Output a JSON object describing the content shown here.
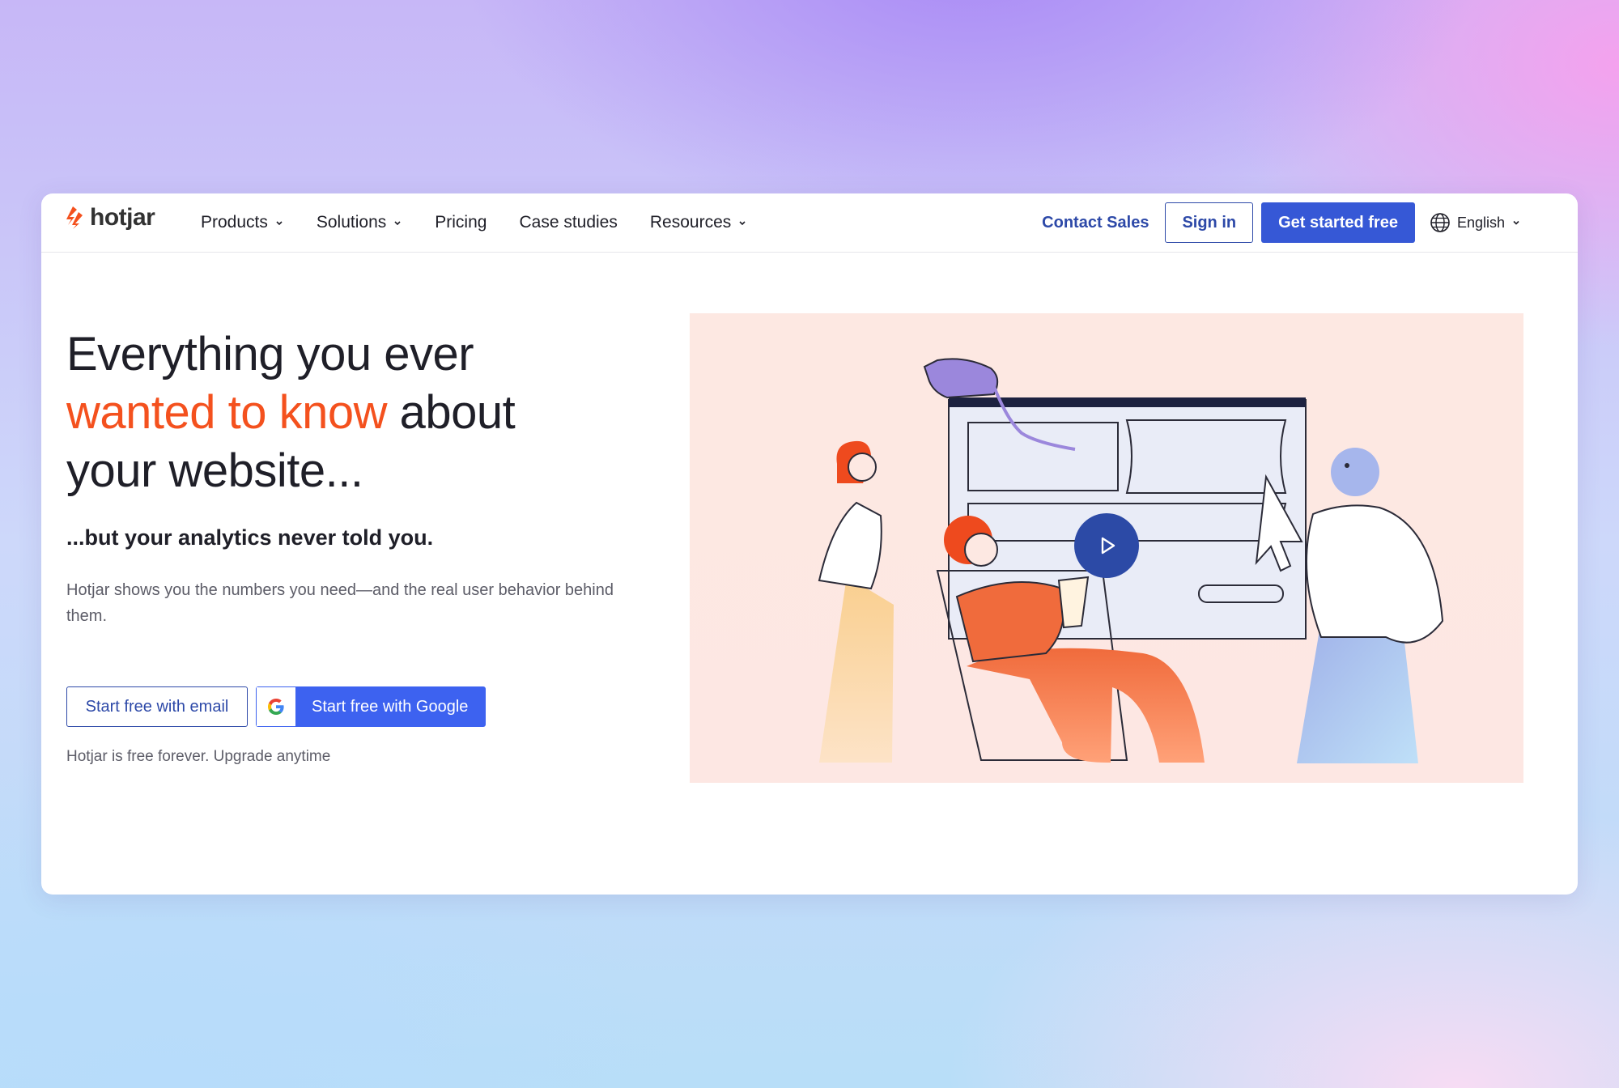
{
  "brand": {
    "name": "hotjar",
    "color": "#f4511e"
  },
  "nav": {
    "items": [
      {
        "label": "Products",
        "has_dropdown": true
      },
      {
        "label": "Solutions",
        "has_dropdown": true
      },
      {
        "label": "Pricing",
        "has_dropdown": false
      },
      {
        "label": "Case studies",
        "has_dropdown": false
      },
      {
        "label": "Resources",
        "has_dropdown": true
      }
    ],
    "contact_sales": "Contact Sales",
    "sign_in": "Sign in",
    "get_started": "Get started free",
    "language": "English"
  },
  "hero": {
    "headline_line1": "Everything you ever",
    "headline_accent": "wanted to know",
    "headline_after_accent": " about",
    "headline_line3": "your website...",
    "subheadline": "...but your analytics never told you.",
    "description": "Hotjar shows you the numbers you need—and the real user behavior behind them.",
    "cta_email": "Start free with email",
    "cta_google": "Start free with Google",
    "free_note": "Hotjar is free forever. Upgrade anytime"
  },
  "colors": {
    "primary_blue": "#3658d6",
    "link_blue": "#2d49a8",
    "accent_orange": "#f4511e",
    "hero_bg": "#fde8e2"
  }
}
